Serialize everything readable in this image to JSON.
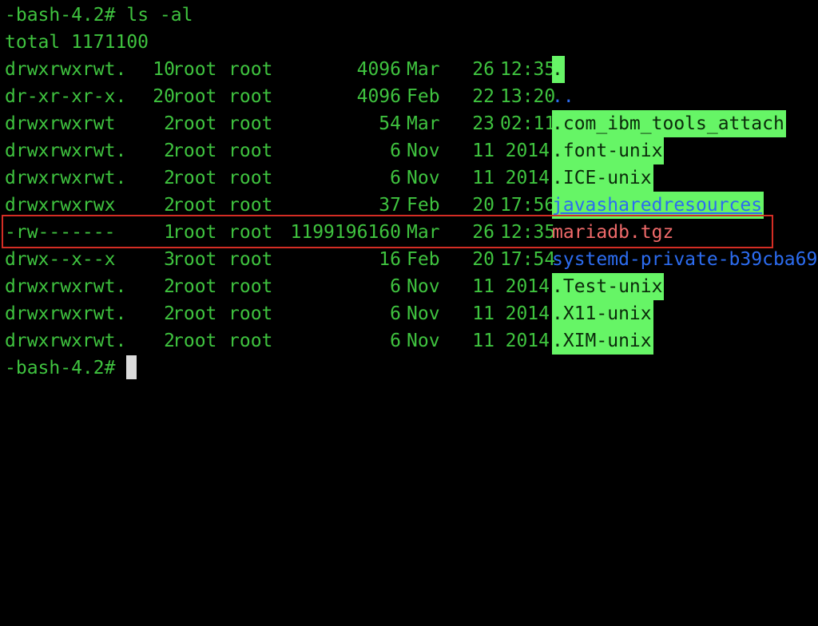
{
  "terminal": {
    "prompt": "-bash-4.2#",
    "command": "ls -al",
    "total_line": "total 1171100",
    "colors": {
      "text": "#3fc33f",
      "dir_highlight": "#66f566",
      "link": "#2c6cf0",
      "archive": "#f06a6a",
      "annotation_box": "#d42d24"
    },
    "rows": [
      {
        "perms": "drwxrwxrwt.",
        "links": "10",
        "owner": "root",
        "group": "root",
        "size": "4096",
        "month": "Mar",
        "day": "26",
        "time": "12:35",
        "name": "."
      },
      {
        "perms": "dr-xr-xr-x.",
        "links": "20",
        "owner": "root",
        "group": "root",
        "size": "4096",
        "month": "Feb",
        "day": "22",
        "time": "13:20",
        "name": ".."
      },
      {
        "perms": "drwxrwxrwt",
        "links": "2",
        "owner": "root",
        "group": "root",
        "size": "54",
        "month": "Mar",
        "day": "23",
        "time": "02:11",
        "name": ".com_ibm_tools_attach"
      },
      {
        "perms": "drwxrwxrwt.",
        "links": "2",
        "owner": "root",
        "group": "root",
        "size": "6",
        "month": "Nov",
        "day": "11",
        "time": "2014",
        "name": ".font-unix"
      },
      {
        "perms": "drwxrwxrwt.",
        "links": "2",
        "owner": "root",
        "group": "root",
        "size": "6",
        "month": "Nov",
        "day": "11",
        "time": "2014",
        "name": ".ICE-unix"
      },
      {
        "perms": "drwxrwxrwx",
        "links": "2",
        "owner": "root",
        "group": "root",
        "size": "37",
        "month": "Feb",
        "day": "20",
        "time": "17:56",
        "name": "javasharedresources"
      },
      {
        "perms": "-rw-------",
        "links": "1",
        "owner": "root",
        "group": "root",
        "size": "1199196160",
        "month": "Mar",
        "day": "26",
        "time": "12:35",
        "name": "mariadb.tgz"
      },
      {
        "perms": "drwx--x--x",
        "links": "3",
        "owner": "root",
        "group": "root",
        "size": "16",
        "month": "Feb",
        "day": "20",
        "time": "17:54",
        "name": "systemd-private-b39cba69"
      },
      {
        "perms": "drwxrwxrwt.",
        "links": "2",
        "owner": "root",
        "group": "root",
        "size": "6",
        "month": "Nov",
        "day": "11",
        "time": "2014",
        "name": ".Test-unix"
      },
      {
        "perms": "drwxrwxrwt.",
        "links": "2",
        "owner": "root",
        "group": "root",
        "size": "6",
        "month": "Nov",
        "day": "11",
        "time": "2014",
        "name": ".X11-unix"
      },
      {
        "perms": "drwxrwxrwt.",
        "links": "2",
        "owner": "root",
        "group": "root",
        "size": "6",
        "month": "Nov",
        "day": "11",
        "time": "2014",
        "name": ".XIM-unix"
      }
    ],
    "final_prompt": "-bash-4.2#"
  }
}
